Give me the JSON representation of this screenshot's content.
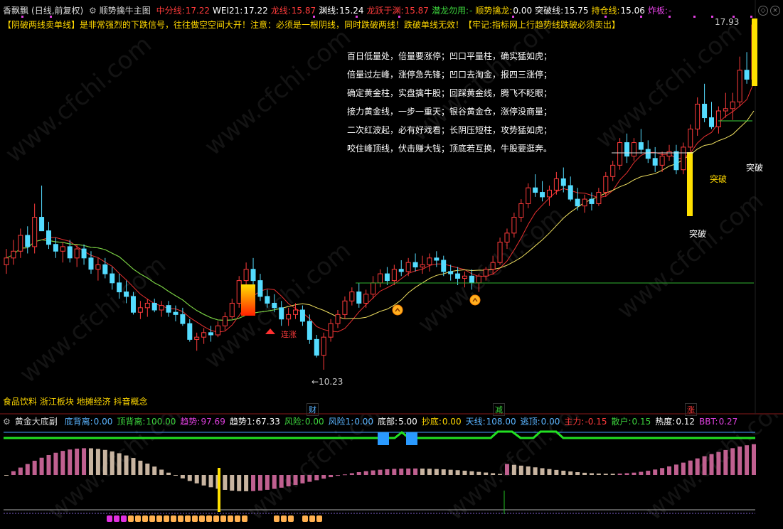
{
  "header": {
    "stock_name": "香飘飘",
    "period": "(日线,前复权)",
    "main_indicator": "顺势擒牛主图",
    "items": [
      {
        "label": "中分线:",
        "value": "17.22",
        "label_color": "#ff3b3b",
        "value_color": "#ff3b3b"
      },
      {
        "label": "WEI21:",
        "value": "17.22",
        "label_color": "#ffffff",
        "value_color": "#ffffff"
      },
      {
        "label": "龙线:",
        "value": "15.87",
        "label_color": "#ff3b3b",
        "value_color": "#ff3b3b"
      },
      {
        "label": "渊线:",
        "value": "15.24",
        "label_color": "#ffffff",
        "value_color": "#ffffff"
      },
      {
        "label": "龙跃于渊:",
        "value": "15.87",
        "label_color": "#ff3b3b",
        "value_color": "#ff3b3b"
      },
      {
        "label": "潜龙勿用:",
        "value": "-",
        "label_color": "#3cd23c",
        "value_color": "#3cd23c"
      },
      {
        "label": "顺势擒龙:",
        "value": "0.00",
        "label_color": "#ffd800",
        "value_color": "#ffffff"
      },
      {
        "label": "突破线:",
        "value": "15.75",
        "label_color": "#ffffff",
        "value_color": "#ffffff"
      },
      {
        "label": "持仓线:",
        "value": "15.06",
        "label_color": "#ffd800",
        "value_color": "#ffffff"
      },
      {
        "label": "炸板:",
        "value": "-",
        "label_color": "#e040e0",
        "value_color": "#e040e0"
      }
    ]
  },
  "notice": "【阴破两线卖单线】是非常强烈的下跌信号，往往做空空间大开！注意：必须是一根阴线，同时跌破两线！跌破单线无效！【牢记:指标网上行趋势线跌破必须卖出】",
  "poem": [
    "百日低量处，倍量要涨停；凹口平量柱，确实猛如虎；",
    "倍量过左峰，涨停急先锋；凹口去淘金，报四三涨停；",
    "确定黄金柱，实盘擒牛股；回踩黄金线，腾飞不眨眼；",
    "接力黄金线，一步一重天；银谷黄金仓，涨停没商量；",
    "二次红波起，必有好戏看；长阴压短柱，攻势猛如虎；",
    "咬住峰顶线，伏击赚大钱；顶底若互换，牛股要逛奔。"
  ],
  "annotations": {
    "high_price": "17.93",
    "low_price": "←10.23",
    "breakout_1": "突破",
    "breakout_2": "突破",
    "breakout_3": "突破",
    "signal_label": "连涨"
  },
  "concepts": "食品饮料 浙江板块  地摊经济 抖音概念",
  "markers": {
    "finance": "财",
    "reduce": "减",
    "rise": "涨"
  },
  "sub_header": {
    "indicator": "黄金大底副",
    "items": [
      {
        "label": "底背离:",
        "value": "0.00",
        "color": "#5ab4ff"
      },
      {
        "label": "顶背离:",
        "value": "100.00",
        "color": "#3cd23c"
      },
      {
        "label": "趋势:",
        "value": "97.69",
        "color": "#e040e0"
      },
      {
        "label": "趋势1:",
        "value": "67.33",
        "color": "#ffffff"
      },
      {
        "label": "风险:",
        "value": "0.00",
        "color": "#3cd23c"
      },
      {
        "label": "风险1:",
        "value": "0.00",
        "color": "#5ab4ff"
      },
      {
        "label": "底部:",
        "value": "5.00",
        "color": "#ffffff"
      },
      {
        "label": "抄底:",
        "value": "0.00",
        "color": "#ffd800"
      },
      {
        "label": "天线:",
        "value": "108.00",
        "color": "#5ab4ff"
      },
      {
        "label": "逃顶:",
        "value": "0.00",
        "color": "#5ab4ff"
      },
      {
        "label": "主力:",
        "value": "-0.15",
        "color": "#ff3b3b"
      },
      {
        "label": "散户:",
        "value": "0.15",
        "color": "#3cd23c"
      },
      {
        "label": "热度:",
        "value": "0.12",
        "color": "#ffffff"
      },
      {
        "label": "BBT:",
        "value": "0.27",
        "color": "#e040e0"
      }
    ]
  },
  "watermark": "www.cfchi.com",
  "colors": {
    "up": "#ff3b3b",
    "down": "#54dcff",
    "ma_red": "#e83030",
    "ma_yellow": "#f0e060",
    "ma_green": "#6ad040",
    "green_line": "#2fb52f",
    "bar_pink": "#c06090",
    "bar_beige": "#c8b4a0"
  },
  "chart_data": {
    "type": "candlestick",
    "y_range": [
      10.23,
      17.93
    ],
    "candles": [
      [
        12.55,
        12.9,
        12.35,
        12.7
      ],
      [
        12.7,
        13.1,
        12.55,
        12.85
      ],
      [
        12.85,
        13.35,
        12.7,
        13.2
      ],
      [
        13.2,
        13.4,
        12.8,
        12.95
      ],
      [
        12.95,
        13.9,
        12.8,
        13.6
      ],
      [
        13.6,
        14.3,
        13.4,
        13.3
      ],
      [
        13.3,
        13.5,
        12.9,
        13.0
      ],
      [
        13.0,
        13.15,
        12.7,
        12.85
      ],
      [
        12.85,
        13.05,
        12.6,
        12.95
      ],
      [
        12.95,
        13.1,
        12.6,
        12.7
      ],
      [
        12.7,
        13.0,
        12.5,
        12.9
      ],
      [
        12.9,
        13.0,
        12.55,
        12.7
      ],
      [
        12.7,
        12.85,
        12.35,
        12.45
      ],
      [
        12.45,
        12.7,
        12.2,
        12.55
      ],
      [
        12.55,
        12.7,
        12.25,
        12.35
      ],
      [
        12.35,
        12.5,
        12.0,
        12.15
      ],
      [
        12.15,
        12.35,
        11.8,
        11.95
      ],
      [
        11.95,
        12.2,
        11.7,
        11.85
      ],
      [
        11.85,
        11.95,
        11.45,
        11.5
      ],
      [
        11.5,
        11.75,
        11.35,
        11.6
      ],
      [
        11.6,
        11.8,
        11.4,
        11.7
      ],
      [
        11.7,
        11.8,
        11.5,
        11.55
      ],
      [
        11.55,
        11.75,
        11.4,
        11.65
      ],
      [
        11.65,
        11.75,
        11.4,
        11.5
      ],
      [
        11.5,
        11.65,
        11.3,
        11.45
      ],
      [
        11.45,
        11.6,
        11.2,
        11.25
      ],
      [
        11.25,
        11.35,
        10.85,
        10.9
      ],
      [
        10.9,
        11.05,
        10.65,
        10.95
      ],
      [
        10.95,
        11.15,
        10.8,
        11.05
      ],
      [
        11.05,
        11.2,
        10.85,
        11.0
      ],
      [
        11.0,
        11.3,
        10.95,
        11.2
      ],
      [
        11.2,
        11.5,
        11.1,
        11.4
      ],
      [
        11.4,
        11.8,
        11.35,
        11.7
      ],
      [
        11.7,
        12.3,
        11.6,
        12.2
      ],
      [
        12.2,
        12.6,
        12.1,
        12.45
      ],
      [
        12.45,
        12.7,
        12.1,
        12.2
      ],
      [
        12.2,
        12.35,
        11.75,
        11.85
      ],
      [
        11.85,
        12.0,
        11.6,
        11.7
      ],
      [
        11.7,
        11.9,
        11.5,
        11.6
      ],
      [
        11.6,
        11.75,
        11.2,
        11.35
      ],
      [
        11.35,
        11.6,
        11.2,
        11.45
      ],
      [
        11.45,
        11.7,
        11.35,
        11.55
      ],
      [
        11.55,
        11.65,
        11.2,
        11.3
      ],
      [
        11.3,
        11.45,
        10.8,
        10.9
      ],
      [
        10.9,
        11.0,
        10.5,
        10.55
      ],
      [
        10.55,
        11.05,
        10.23,
        10.95
      ],
      [
        10.95,
        11.35,
        10.85,
        11.25
      ],
      [
        11.25,
        11.55,
        11.15,
        11.45
      ],
      [
        11.45,
        11.85,
        11.35,
        11.75
      ],
      [
        11.75,
        12.05,
        11.65,
        11.95
      ],
      [
        11.95,
        12.15,
        11.6,
        11.7
      ],
      [
        11.7,
        12.0,
        11.6,
        11.9
      ],
      [
        11.9,
        12.3,
        11.8,
        12.15
      ],
      [
        12.15,
        12.45,
        12.05,
        12.35
      ],
      [
        12.35,
        12.5,
        12.1,
        12.2
      ],
      [
        12.2,
        12.55,
        12.1,
        12.45
      ],
      [
        12.45,
        12.65,
        12.3,
        12.4
      ],
      [
        12.4,
        12.7,
        12.3,
        12.6
      ],
      [
        12.6,
        12.8,
        12.4,
        12.5
      ],
      [
        12.5,
        12.75,
        12.35,
        12.55
      ],
      [
        12.55,
        12.8,
        12.4,
        12.7
      ],
      [
        12.7,
        12.85,
        12.5,
        12.65
      ],
      [
        12.65,
        12.75,
        12.3,
        12.4
      ],
      [
        12.4,
        12.55,
        12.2,
        12.35
      ],
      [
        12.35,
        12.5,
        12.1,
        12.25
      ],
      [
        12.25,
        12.4,
        12.05,
        12.3
      ],
      [
        12.3,
        12.45,
        12.0,
        12.15
      ],
      [
        12.15,
        12.35,
        11.95,
        12.3
      ],
      [
        12.3,
        12.5,
        12.2,
        12.45
      ],
      [
        12.45,
        12.75,
        12.35,
        12.6
      ],
      [
        12.6,
        13.15,
        12.55,
        13.05
      ],
      [
        13.05,
        13.35,
        12.9,
        13.25
      ],
      [
        13.25,
        13.7,
        13.15,
        13.6
      ],
      [
        13.6,
        14.0,
        13.5,
        13.9
      ],
      [
        13.9,
        14.35,
        13.8,
        14.25
      ],
      [
        14.25,
        14.55,
        14.05,
        14.15
      ],
      [
        14.15,
        14.4,
        13.95,
        14.05
      ],
      [
        14.05,
        14.3,
        13.85,
        14.2
      ],
      [
        14.2,
        14.6,
        14.1,
        14.45
      ],
      [
        14.45,
        14.7,
        14.15,
        14.3
      ],
      [
        14.3,
        14.5,
        13.95,
        14.0
      ],
      [
        14.0,
        14.25,
        13.75,
        13.85
      ],
      [
        13.85,
        14.1,
        13.7,
        14.0
      ],
      [
        14.0,
        14.15,
        13.75,
        13.9
      ],
      [
        13.9,
        14.25,
        13.85,
        14.15
      ],
      [
        14.15,
        14.6,
        14.05,
        14.5
      ],
      [
        14.5,
        14.85,
        14.4,
        14.75
      ],
      [
        14.75,
        15.35,
        14.65,
        15.25
      ],
      [
        15.25,
        15.45,
        14.8,
        14.95
      ],
      [
        14.95,
        15.35,
        14.85,
        15.25
      ],
      [
        15.25,
        15.55,
        15.0,
        15.1
      ],
      [
        15.1,
        15.3,
        14.8,
        14.9
      ],
      [
        14.9,
        15.15,
        14.6,
        14.75
      ],
      [
        14.75,
        15.05,
        14.6,
        14.95
      ],
      [
        14.95,
        15.2,
        14.85,
        15.05
      ],
      [
        15.05,
        15.2,
        14.55,
        14.65
      ],
      [
        14.65,
        15.25,
        14.55,
        15.15
      ],
      [
        15.15,
        15.65,
        15.05,
        15.55
      ],
      [
        15.55,
        16.25,
        15.4,
        16.1
      ],
      [
        16.1,
        16.55,
        15.7,
        15.8
      ],
      [
        15.8,
        16.15,
        15.55,
        15.6
      ],
      [
        15.6,
        16.05,
        15.45,
        15.95
      ],
      [
        15.95,
        16.35,
        15.8,
        16.0
      ],
      [
        16.0,
        16.35,
        15.75,
        16.15
      ],
      [
        16.15,
        17.15,
        16.05,
        16.85
      ],
      [
        16.85,
        17.25,
        16.55,
        16.65
      ],
      [
        16.65,
        17.93,
        16.55,
        17.85
      ]
    ]
  }
}
